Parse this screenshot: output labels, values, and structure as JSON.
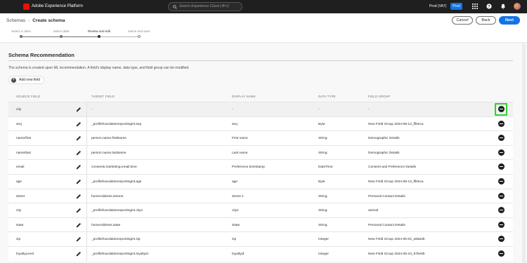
{
  "app": {
    "brand": "Adobe Experience Platform",
    "search_placeholder": "Search Experience Cloud (⌘+/)",
    "org": "Prod (VA7)",
    "env_badge": "Prod",
    "icons": [
      "adobe-logo-icon",
      "search-icon",
      "apps-grid-icon",
      "help-icon",
      "notifications-bell-icon",
      "avatar"
    ]
  },
  "breadcrumb": {
    "parent": "Schemas",
    "separator": "›",
    "current": "Create schema"
  },
  "actions": {
    "cancel": "Cancel",
    "back": "Back",
    "next": "Next"
  },
  "steps": [
    {
      "label": "Select a class",
      "state": "done"
    },
    {
      "label": "Select data",
      "state": "done"
    },
    {
      "label": "Review and edit",
      "state": "active"
    },
    {
      "label": "Name and save",
      "state": "pending"
    }
  ],
  "section": {
    "title": "Schema Recommendation",
    "description": "The schema is created upon ML recommendation. A field's display name, data type, and field group can be modified.",
    "add_field": "Add new field"
  },
  "table": {
    "columns": [
      "SOURCE FIELD",
      "TARGET FIELD",
      "DISPLAY NAME",
      "DATA TYPE",
      "FIELD GROUP"
    ],
    "rows": [
      {
        "source": "city",
        "target": "-",
        "display": "-",
        "type": "-",
        "group": "-"
      },
      {
        "source": "seq",
        "target": "_profilefoundationreportingint.seq",
        "display": "seq",
        "type": "Byte",
        "group": "New Field Group 2024-08-12_ffi0eca"
      },
      {
        "source": "name/first",
        "target": "person.name.firstName",
        "display": "First name",
        "type": "String",
        "group": "Demographic Details"
      },
      {
        "source": "name/last",
        "target": "person.name.lastName",
        "display": "Last name",
        "type": "String",
        "group": "Demographic Details"
      },
      {
        "source": "email",
        "target": "consents.marketing.email.time",
        "display": "Preference timestamp",
        "type": "DateTime",
        "group": "Consent and Preference Details"
      },
      {
        "source": "age",
        "target": "_profilefoundationreportingint.age",
        "display": "age",
        "type": "Byte",
        "group": "New Field Group 2024-08-12_ffi0eca"
      },
      {
        "source": "street",
        "target": "homeAddress.street1",
        "display": "Street 1",
        "type": "String",
        "group": "Personal Contact Details"
      },
      {
        "source": "city",
        "target": "_profilefoundationreportingint.city1",
        "display": "city1",
        "type": "String",
        "group": "animal"
      },
      {
        "source": "state",
        "target": "homeAddress.state",
        "display": "State",
        "type": "String",
        "group": "Personal Contact Details"
      },
      {
        "source": "zip",
        "target": "_profilefoundationreportingint.zip",
        "display": "zip",
        "type": "Integer",
        "group": "New Field Group 2024-05-02_a59a3b"
      },
      {
        "source": "loyaltyLevel",
        "target": "_profilefoundationreportingint.loyaltyid",
        "display": "loyaltyid",
        "type": "Integer",
        "group": "New Field Group 2024-05-23_97be6b"
      }
    ]
  },
  "colors": {
    "accent": "#1473e6",
    "highlight": "#2bd22b",
    "topbar": "#1f1f1f",
    "adobe_red": "#eb1000"
  }
}
